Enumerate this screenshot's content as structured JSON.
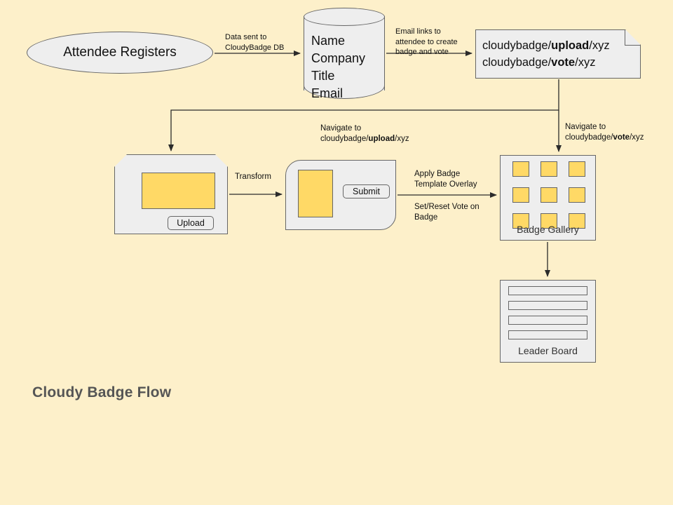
{
  "canvas": {
    "background": "#fdf0ca",
    "shape_fill": "#eeeeee",
    "accent_fill": "#ffd966",
    "stroke": "#666666",
    "title_color": "#555555"
  },
  "title": "Cloudy Badge Flow",
  "nodes": {
    "start": {
      "label": "Attendee Registers",
      "shape": "ellipse"
    },
    "database": {
      "shape": "cylinder",
      "fields": [
        "Name",
        "Company",
        "Title",
        "Email"
      ]
    },
    "note": {
      "shape": "note",
      "lines": [
        {
          "prefix": "cloudybadge/",
          "bold": "upload",
          "suffix": "/xyz"
        },
        {
          "prefix": "cloudybadge/",
          "bold": "vote",
          "suffix": "/xyz"
        }
      ]
    },
    "upload_page": {
      "shape": "notched-card",
      "image_placeholder": "badge-photo",
      "button_label": "Upload"
    },
    "transform_page": {
      "shape": "rounded-card",
      "image_placeholder": "badge-photo",
      "button_label": "Submit"
    },
    "badge_gallery": {
      "shape": "rectangle",
      "caption": "Badge Gallery",
      "tiles": 9
    },
    "leader_board": {
      "shape": "rectangle",
      "caption": "Leader Board",
      "rows": 4
    }
  },
  "edge_labels": {
    "register_to_db": [
      "Data sent to",
      "CloudyBadge DB"
    ],
    "db_to_note": [
      "Email links to",
      "attendee to create",
      "badge and vote"
    ],
    "note_to_upload": {
      "line1": "Navigate to",
      "line2_prefix": "cloudybadge/",
      "line2_bold": "upload",
      "line2_suffix": "/xyz"
    },
    "note_to_gallery": {
      "line1": "Navigate to",
      "line2_prefix": "cloudybadge/",
      "line2_bold": "vote",
      "line2_suffix": "/xyz"
    },
    "upload_to_transform": [
      "Transform"
    ],
    "transform_to_gallery_above": [
      "Apply Badge",
      "Template Overlay"
    ],
    "transform_to_gallery_below": [
      "Set/Reset Vote on",
      "Badge"
    ]
  }
}
